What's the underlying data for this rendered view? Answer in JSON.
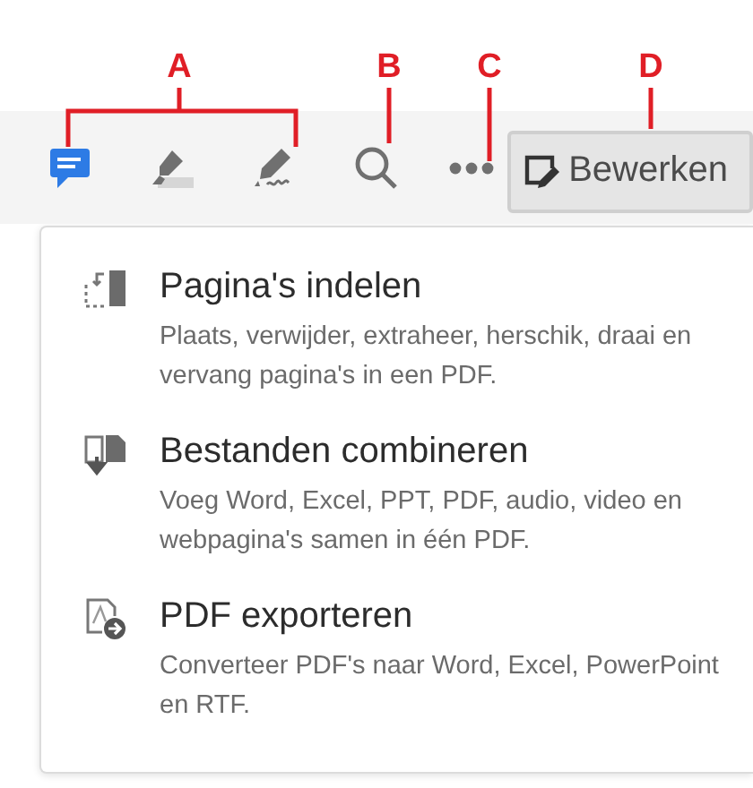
{
  "annotations": [
    {
      "label": "A"
    },
    {
      "label": "B"
    },
    {
      "label": "C"
    },
    {
      "label": "D"
    }
  ],
  "toolbar": {
    "tools": [
      {
        "kind": "comment"
      },
      {
        "kind": "highlight"
      },
      {
        "kind": "sign"
      },
      {
        "kind": "search"
      },
      {
        "kind": "more"
      }
    ],
    "edit_button": {
      "label": "Bewerken"
    }
  },
  "menu": {
    "items": [
      {
        "kind": "organize",
        "title": "Pagina's indelen",
        "description": "Plaats, verwijder, extraheer, herschik, draai en vervang pagina's in een PDF."
      },
      {
        "kind": "combine",
        "title": "Bestanden combineren",
        "description": "Voeg Word, Excel, PPT, PDF, audio, video en webpagina's samen in één PDF."
      },
      {
        "kind": "export",
        "title": "PDF exporteren",
        "description": "Converteer PDF's naar Word, Excel, PowerPoint en RTF."
      }
    ]
  }
}
